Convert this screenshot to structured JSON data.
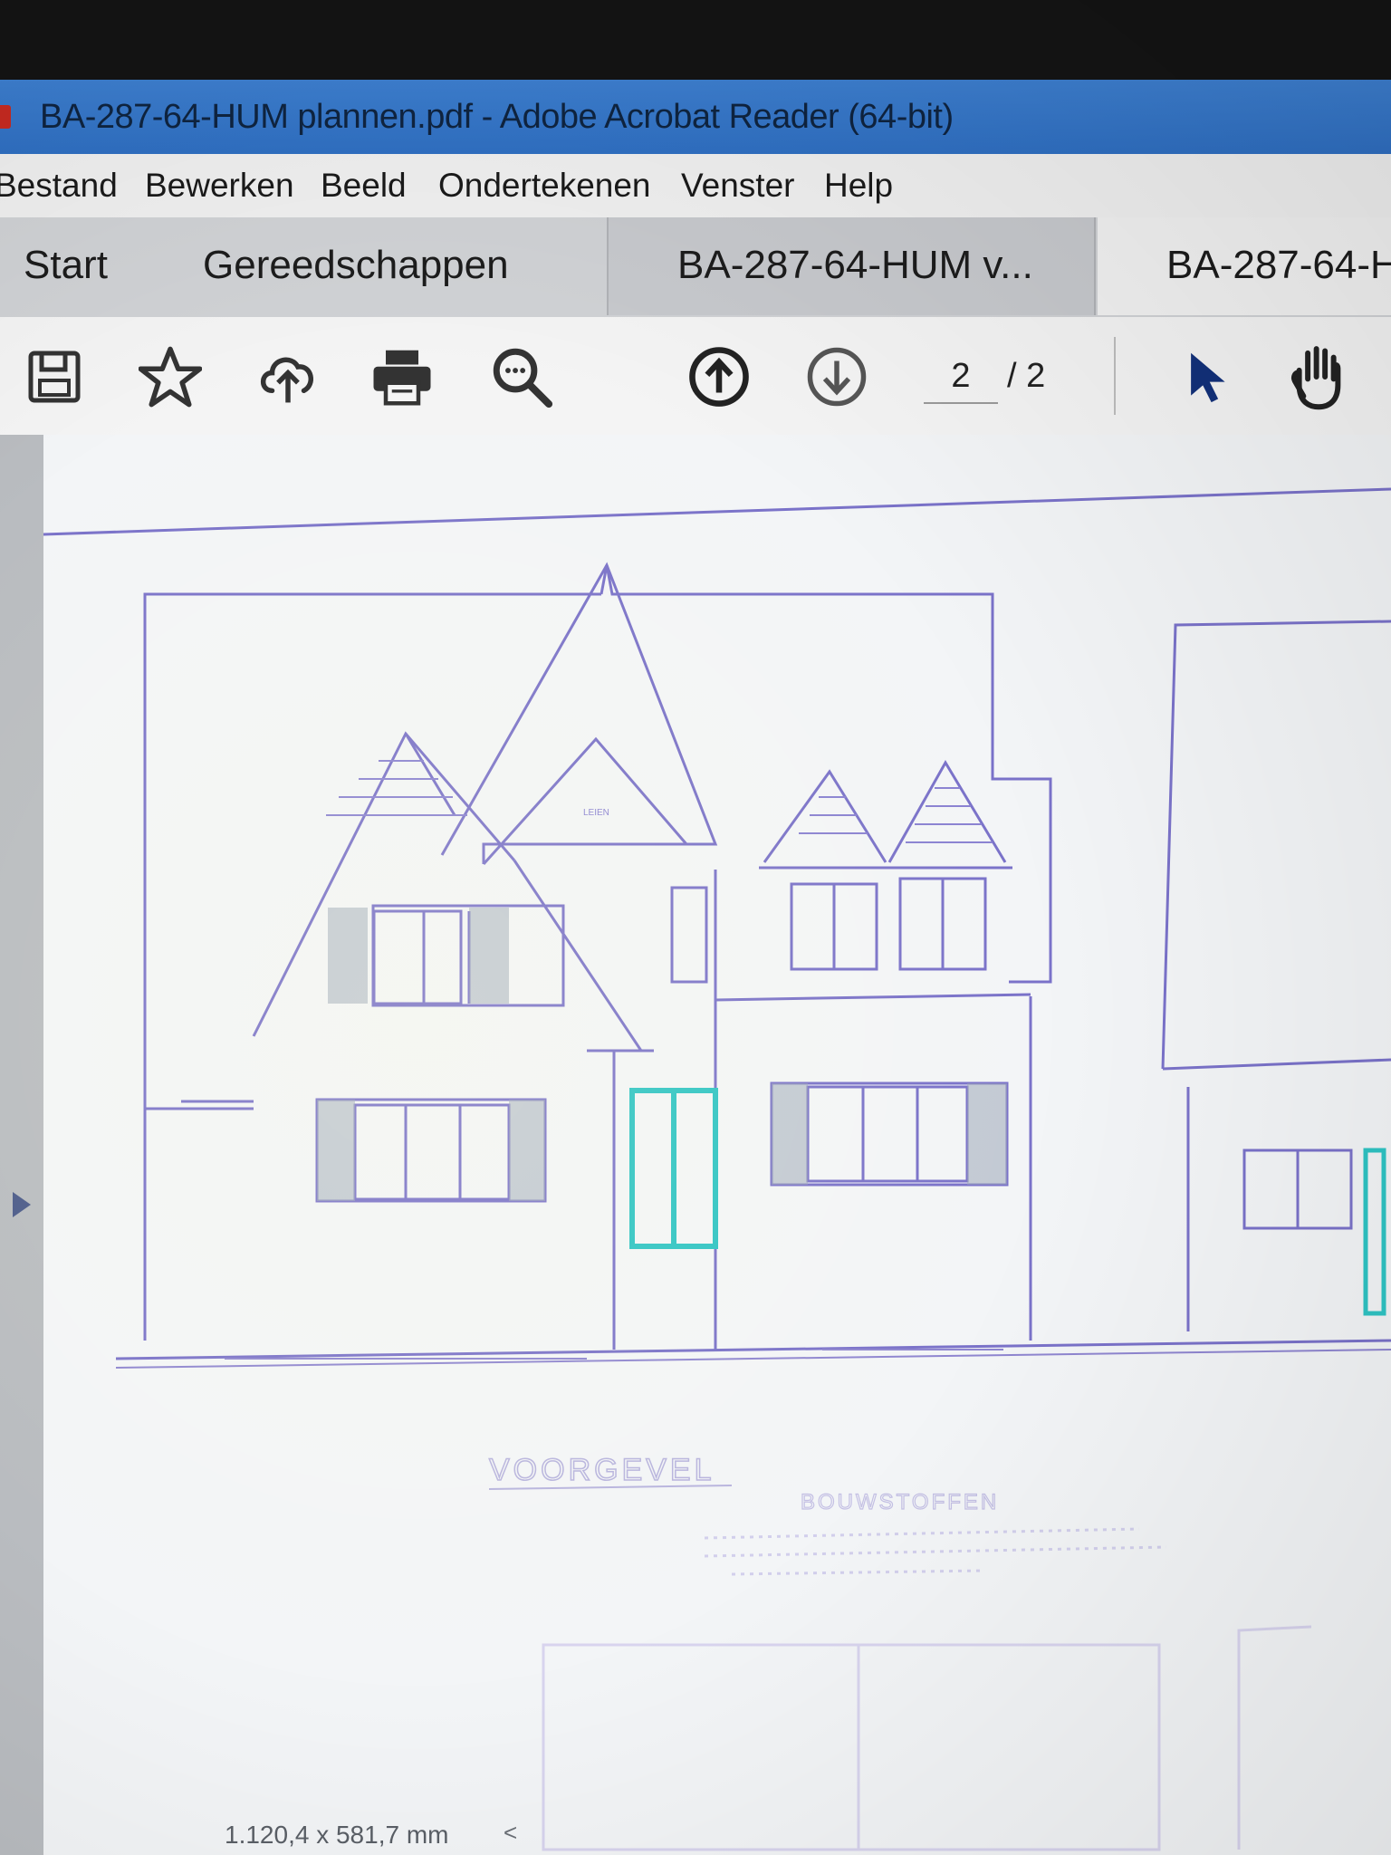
{
  "window": {
    "title": "BA-287-64-HUM plannen.pdf - Adobe Acrobat Reader (64-bit)"
  },
  "menu": {
    "items": [
      "Bestand",
      "Bewerken",
      "Beeld",
      "Ondertekenen",
      "Venster",
      "Help"
    ]
  },
  "tabs": {
    "start": "Start",
    "tools": "Gereedschappen",
    "doc1": "BA-287-64-HUM v...",
    "doc2": "BA-287-64-H"
  },
  "toolbar": {
    "icons": [
      "save-icon",
      "star-icon",
      "upload-cloud-icon",
      "print-icon",
      "zoom-search-icon",
      "page-up-icon",
      "page-down-icon",
      "select-cursor-icon",
      "hand-tool-icon"
    ],
    "current_page": "2",
    "page_total": "/ 2"
  },
  "document": {
    "drawing_label": "VOORGEVEL",
    "materials_heading": "BOUWSTOFFEN",
    "gable_label": "LEIEN"
  },
  "status": {
    "page_size": "1.120,4 x 581,7 mm",
    "scroll_glyph": "<"
  },
  "colors": {
    "titlebar": "#3d7fd0",
    "drawing_line": "#7a72c9",
    "door_highlight": "#2ec4c4"
  }
}
